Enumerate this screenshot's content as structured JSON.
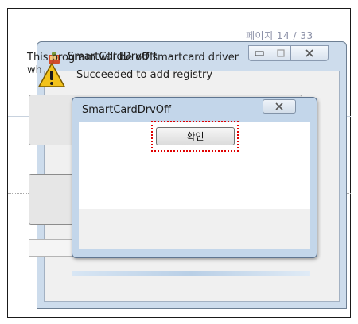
{
  "document": {
    "page_indicator": "페이지 14 / 33"
  },
  "main_window": {
    "title": "SmartCardDrvOff",
    "description_line1": "This program will be off smartcard driver",
    "description_line2": "wh",
    "controls": {
      "minimize": "▭",
      "maximize": "□",
      "close": "✕"
    }
  },
  "message_box": {
    "title": "SmartCardDrvOff",
    "close_label": "✕",
    "message": "Succeeded to add registry",
    "icon": "warning-icon",
    "ok_label": "확인"
  },
  "colors": {
    "title_bar": "#cddcec",
    "message_frame": "#c3d6ea",
    "highlight": "#e00000",
    "warning_fill": "#f2c21b"
  }
}
